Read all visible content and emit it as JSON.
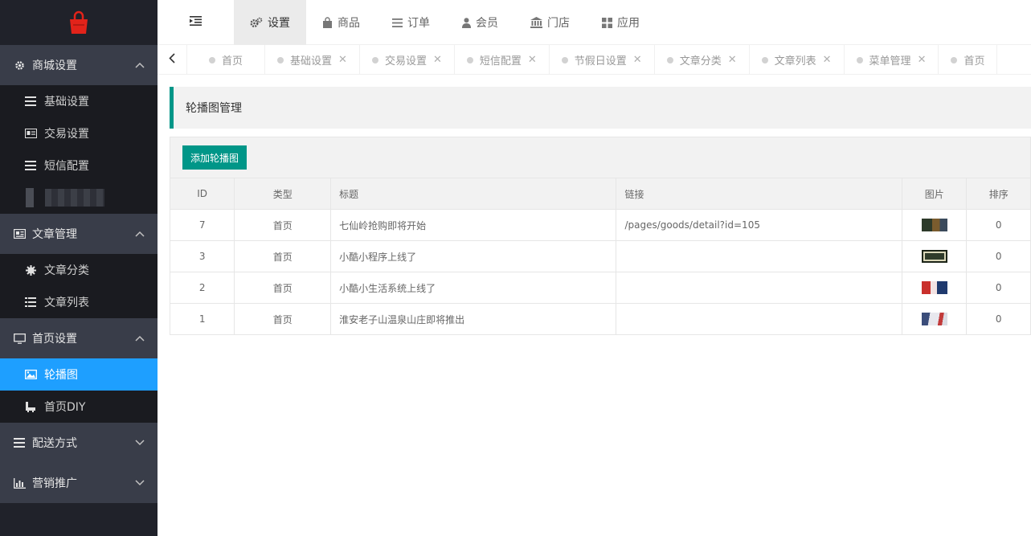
{
  "sidebar": {
    "groups": [
      {
        "label": "商城设置",
        "items": [
          {
            "label": "基础设置"
          },
          {
            "label": "交易设置"
          },
          {
            "label": "短信配置"
          }
        ]
      },
      {
        "label": "文章管理",
        "items": [
          {
            "label": "文章分类"
          },
          {
            "label": "文章列表"
          }
        ]
      },
      {
        "label": "首页设置",
        "items": [
          {
            "label": "轮播图"
          },
          {
            "label": "首页DIY"
          }
        ]
      },
      {
        "label": "配送方式"
      },
      {
        "label": "营销推广"
      }
    ]
  },
  "topnav": {
    "tabs": [
      {
        "label": "设置"
      },
      {
        "label": "商品"
      },
      {
        "label": "订单"
      },
      {
        "label": "会员"
      },
      {
        "label": "门店"
      },
      {
        "label": "应用"
      }
    ]
  },
  "pagetabs": [
    {
      "label": "首页"
    },
    {
      "label": "基础设置"
    },
    {
      "label": "交易设置"
    },
    {
      "label": "短信配置"
    },
    {
      "label": "节假日设置"
    },
    {
      "label": "文章分类"
    },
    {
      "label": "文章列表"
    },
    {
      "label": "菜单管理"
    },
    {
      "label": "首页"
    }
  ],
  "page": {
    "title": "轮播图管理",
    "add_button": "添加轮播图"
  },
  "table": {
    "columns": [
      "ID",
      "类型",
      "标题",
      "链接",
      "图片",
      "排序"
    ],
    "rows": [
      {
        "id": "7",
        "type": "首页",
        "title": "七仙岭抢购即将开始",
        "link": "/pages/goods/detail?id=105",
        "sort": "0"
      },
      {
        "id": "3",
        "type": "首页",
        "title": "小酷小程序上线了",
        "link": "",
        "sort": "0"
      },
      {
        "id": "2",
        "type": "首页",
        "title": "小酷小生活系统上线了",
        "link": "",
        "sort": "0"
      },
      {
        "id": "1",
        "type": "首页",
        "title": "淮安老子山温泉山庄即将推出",
        "link": "",
        "sort": "0"
      }
    ]
  },
  "colors": {
    "sidebar_bg": "#20222a",
    "group_bg": "#393d49",
    "active_item": "#1e9fff",
    "primary": "#009688"
  },
  "icons": [
    "bag-logo-icon",
    "gear-icon",
    "list-icon",
    "id-card-icon",
    "news-icon",
    "asterisk-icon",
    "monitor-icon",
    "image-icon",
    "brush-icon",
    "bars-icon",
    "chart-icon",
    "chevron-up-icon",
    "chevron-down-icon",
    "indent-icon",
    "cogs-icon",
    "shopping-bag-icon",
    "user-icon",
    "bank-icon",
    "grid-icon",
    "chevron-left-icon",
    "close-icon"
  ]
}
